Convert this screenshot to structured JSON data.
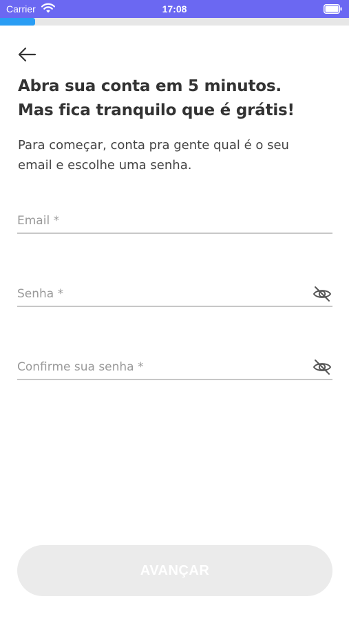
{
  "status_bar": {
    "carrier": "Carrier",
    "time": "17:08",
    "background": "#6b68f2"
  },
  "progress": {
    "value_fraction": 0.1,
    "color": "#2a9df4"
  },
  "header": {
    "back_icon": "arrow-left-icon",
    "title_line_1": "Abra sua conta em 5 minutos.",
    "title_line_2": "Mas fica tranquilo que é grátis!",
    "subtitle_line_1": "Para começar, conta pra gente qual é o seu",
    "subtitle_line_2": "email e escolhe uma senha."
  },
  "form": {
    "email": {
      "placeholder": "Email *",
      "value": ""
    },
    "password": {
      "placeholder": "Senha *",
      "value": "",
      "toggle_icon": "eye-off-icon"
    },
    "confirm_password": {
      "placeholder": "Confirme sua senha *",
      "value": "",
      "toggle_icon": "eye-off-icon"
    }
  },
  "footer": {
    "submit_label": "AVANÇAR",
    "submit_state": "disabled"
  }
}
